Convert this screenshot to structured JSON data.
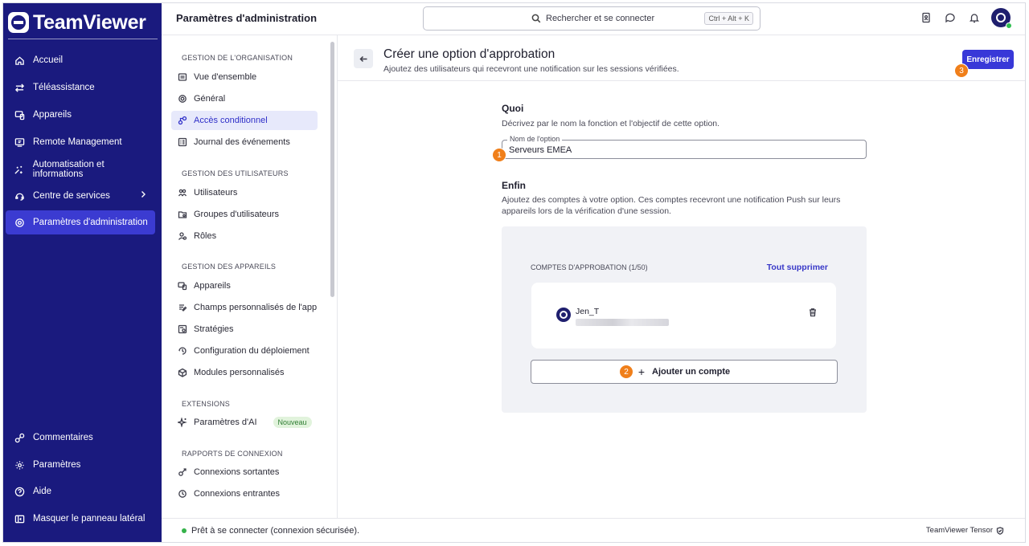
{
  "brand": {
    "name": "TeamViewer"
  },
  "nav": {
    "items": [
      {
        "label": "Accueil",
        "icon": "home-icon"
      },
      {
        "label": "Téléassistance",
        "icon": "arrows-icon"
      },
      {
        "label": "Appareils",
        "icon": "devices-icon"
      },
      {
        "label": "Remote Management",
        "icon": "remote-management-icon"
      },
      {
        "label": "Automatisation et informations",
        "icon": "automation-icon"
      },
      {
        "label": "Centre de services",
        "icon": "service-center-icon"
      },
      {
        "label": "Paramètres d'administration",
        "icon": "admin-settings-icon"
      }
    ],
    "bottom": [
      {
        "label": "Commentaires",
        "icon": "feedback-icon"
      },
      {
        "label": "Paramètres",
        "icon": "settings-icon"
      },
      {
        "label": "Aide",
        "icon": "help-icon"
      },
      {
        "label": "Masquer le panneau latéral",
        "icon": "collapse-panel-icon"
      }
    ]
  },
  "topbar": {
    "title": "Paramètres d'administration",
    "search_placeholder": "Rechercher et se connecter",
    "search_shortcut": "Ctrl + Alt + K"
  },
  "submenu": {
    "sections": {
      "org": "GESTION DE L'ORGANISATION",
      "users": "GESTION DES UTILISATEURS",
      "devices": "GESTION DES APPAREILS",
      "extensions": "EXTENSIONS",
      "reports": "RAPPORTS DE CONNEXION"
    },
    "items": {
      "overview": "Vue d'ensemble",
      "general": "Général",
      "conditional_access": "Accès conditionnel",
      "event_log": "Journal des événements",
      "users": "Utilisateurs",
      "user_groups": "Groupes d'utilisateurs",
      "roles": "Rôles",
      "devices": "Appareils",
      "custom_fields": "Champs personnalisés de l'app",
      "policies": "Stratégies",
      "deployment": "Configuration du déploiement",
      "custom_modules": "Modules personnalisés",
      "ai_settings": "Paramètres d'AI",
      "outgoing": "Connexions sortantes",
      "incoming": "Connexions entrantes"
    },
    "new_badge": "Nouveau"
  },
  "page": {
    "title": "Créer une option d'approbation",
    "subtitle": "Ajoutez des utilisateurs qui recevront une notification sur les sessions vérifiées.",
    "save": "Enregistrer",
    "what_title": "Quoi",
    "what_desc": "Décrivez par le nom la fonction et l'objectif de cette option.",
    "option_label": "Nom de l'option",
    "option_value": "Serveurs EMEA",
    "finally_title": "Enfin",
    "finally_desc": "Ajoutez des comptes à votre option. Ces comptes recevront une notification Push sur leurs appareils lors de la vérification d'une session.",
    "approvers_header": "COMPTES D'APPROBATION (1/50)",
    "clear_all": "Tout supprimer",
    "account_name": "Jen_T",
    "add_account": "Ajouter un compte"
  },
  "steps": [
    "1",
    "2",
    "3"
  ],
  "status": {
    "text": "Prêt à se connecter (connexion sécurisée).",
    "tensor": "TeamViewer Tensor"
  },
  "colors": {
    "nav_bg": "#1a1a7e",
    "accent": "#3838d8",
    "step_badge": "#f07f1a",
    "online": "#35b24a"
  }
}
